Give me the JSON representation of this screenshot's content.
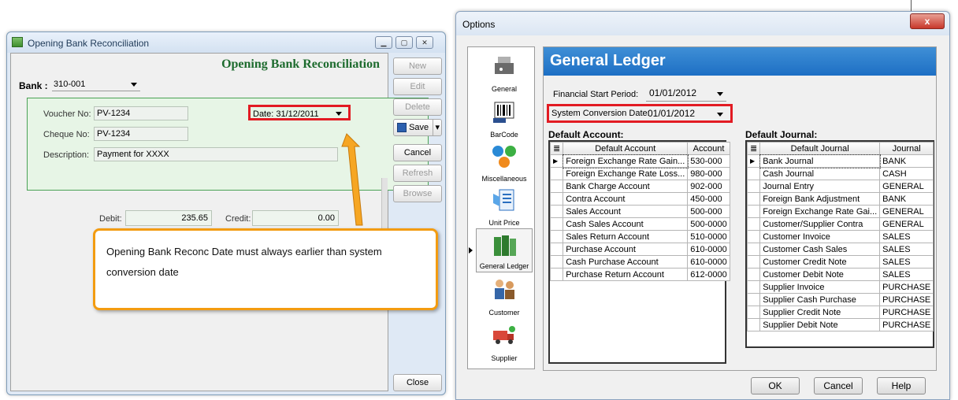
{
  "left_window": {
    "title": "Opening Bank Reconciliation",
    "heading": "Opening Bank Reconciliation",
    "bank_label": "Bank :",
    "bank_value": "310-001",
    "voucher_label": "Voucher No:",
    "voucher_value": "PV-1234",
    "cheque_label": "Cheque No:",
    "cheque_value": "PV-1234",
    "description_label": "Description:",
    "description_value": "Payment for XXXX",
    "date_label": "Date:",
    "date_value": "31/12/2011",
    "debit_label": "Debit:",
    "debit_value": "235.65",
    "credit_label": "Credit:",
    "credit_value": "0.00",
    "buttons": {
      "new": "New",
      "edit": "Edit",
      "delete": "Delete",
      "save": "Save",
      "cancel": "Cancel",
      "refresh": "Refresh",
      "browse": "Browse",
      "close": "Close"
    }
  },
  "callout": {
    "text": "Opening Bank Reconc Date must always earlier than system conversion date"
  },
  "options": {
    "title": "Options",
    "close_glyph": "x",
    "nav_items": [
      {
        "label": "General"
      },
      {
        "label": "BarCode"
      },
      {
        "label": "Miscellaneous"
      },
      {
        "label": "Unit Price"
      },
      {
        "label": "General Ledger"
      },
      {
        "label": "Customer"
      },
      {
        "label": "Supplier"
      }
    ],
    "section_header": "General Ledger",
    "financial_start_label": "Financial Start Period:",
    "financial_start_value": "01/01/2012",
    "conversion_label": "System Conversion Date:",
    "conversion_value": "01/01/2012",
    "default_account_title": "Default Account:",
    "default_account_columns": [
      "Default Account",
      "Account"
    ],
    "default_accounts": [
      [
        "Foreign Exchange Rate Gain...",
        "530-000"
      ],
      [
        "Foreign Exchange Rate Loss...",
        "980-000"
      ],
      [
        "Bank Charge Account",
        "902-000"
      ],
      [
        "Contra Account",
        "450-000"
      ],
      [
        "Sales Account",
        "500-000"
      ],
      [
        "Cash Sales Account",
        "500-0000"
      ],
      [
        "Sales Return Account",
        "510-0000"
      ],
      [
        "Purchase Account",
        "610-0000"
      ],
      [
        "Cash Purchase Account",
        "610-0000"
      ],
      [
        "Purchase Return Account",
        "612-0000"
      ]
    ],
    "default_journal_title": "Default Journal:",
    "default_journal_columns": [
      "Default Journal",
      "Journal"
    ],
    "default_journals": [
      [
        "Bank Journal",
        "BANK"
      ],
      [
        "Cash Journal",
        "CASH"
      ],
      [
        "Journal Entry",
        "GENERAL"
      ],
      [
        "Foreign Bank Adjustment",
        "BANK"
      ],
      [
        "Foreign Exchange Rate Gai...",
        "GENERAL"
      ],
      [
        "Customer/Supplier Contra",
        "GENERAL"
      ],
      [
        "Customer Invoice",
        "SALES"
      ],
      [
        "Customer Cash Sales",
        "SALES"
      ],
      [
        "Customer Credit Note",
        "SALES"
      ],
      [
        "Customer Debit Note",
        "SALES"
      ],
      [
        "Supplier Invoice",
        "PURCHASE"
      ],
      [
        "Supplier Cash Purchase",
        "PURCHASE"
      ],
      [
        "Supplier Credit Note",
        "PURCHASE"
      ],
      [
        "Supplier Debit Note",
        "PURCHASE"
      ]
    ],
    "buttons": {
      "ok": "OK",
      "cancel": "Cancel",
      "help": "Help"
    }
  },
  "colors": {
    "highlight_red": "#e21b23",
    "callout_orange": "#f39c11",
    "header_blue": "#1d6fc4",
    "heading_green": "#1d6b2e"
  }
}
